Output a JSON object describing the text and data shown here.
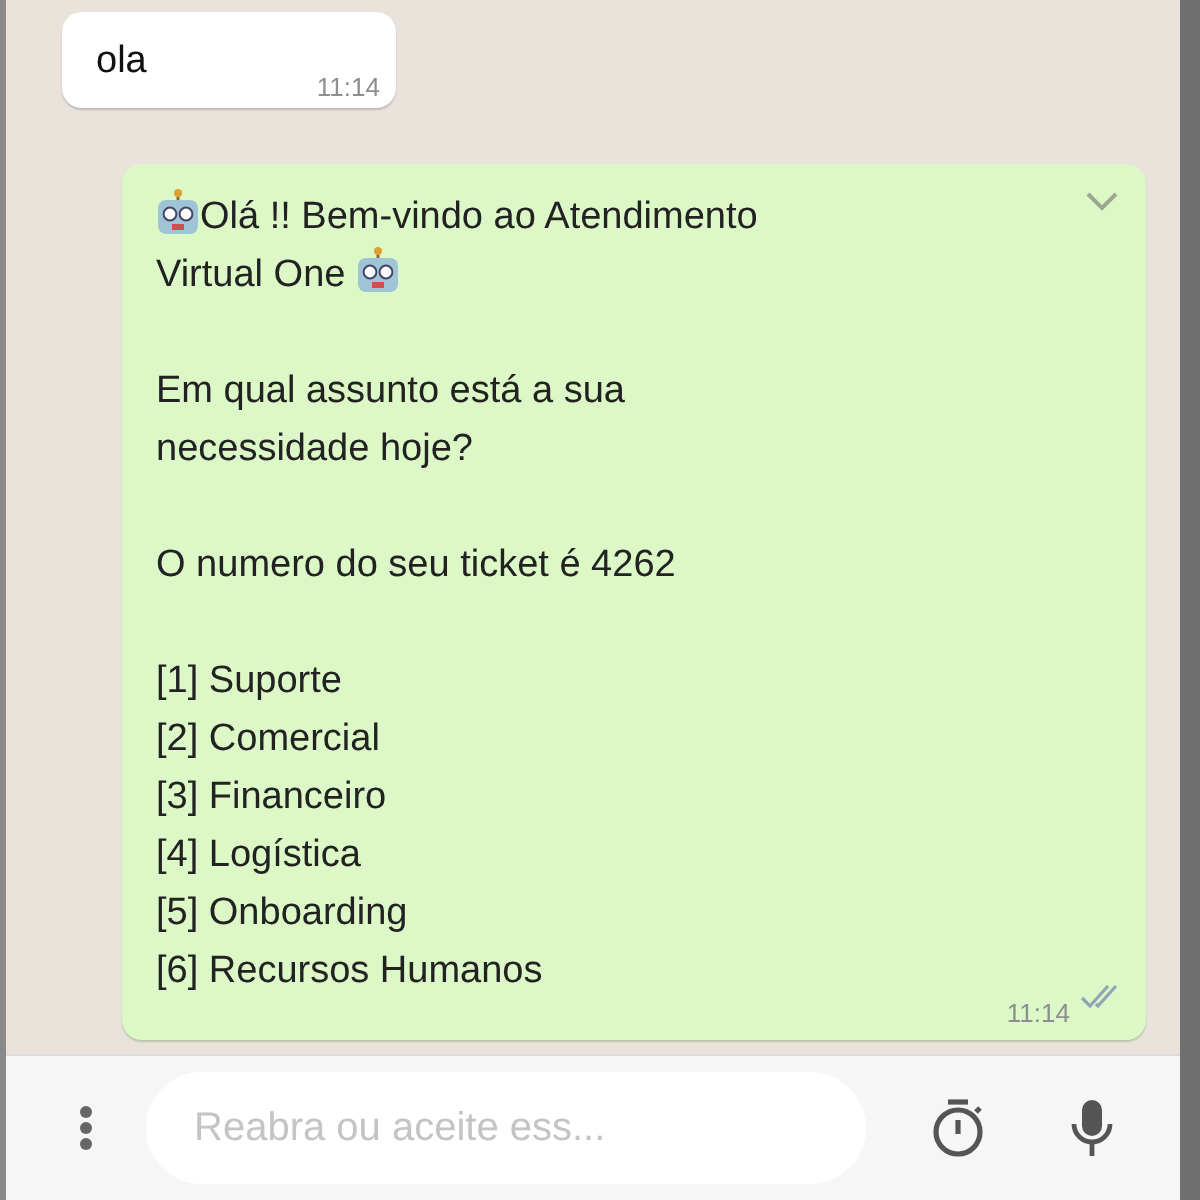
{
  "incoming": {
    "text": "ola",
    "time": "11:14"
  },
  "outgoing": {
    "time": "11:14",
    "read": true,
    "paragraphs": [
      {
        "kind": "greeting",
        "lines": [
          "Olá !! Bem-vindo ao Atendimento",
          "Virtual One"
        ]
      },
      {
        "kind": "plain",
        "lines": [
          "Em qual assunto está a sua",
          "necessidade hoje?"
        ]
      },
      {
        "kind": "plain",
        "lines": [
          "O numero do seu ticket é 4262"
        ]
      },
      {
        "kind": "plain",
        "lines": [
          "[1] Suporte",
          "[2] Comercial",
          "[3] Financeiro",
          "[4] Logística",
          "[5] Onboarding",
          "[6] Recursos Humanos"
        ]
      }
    ]
  },
  "composer": {
    "placeholder": "Reabra ou aceite ess..."
  }
}
